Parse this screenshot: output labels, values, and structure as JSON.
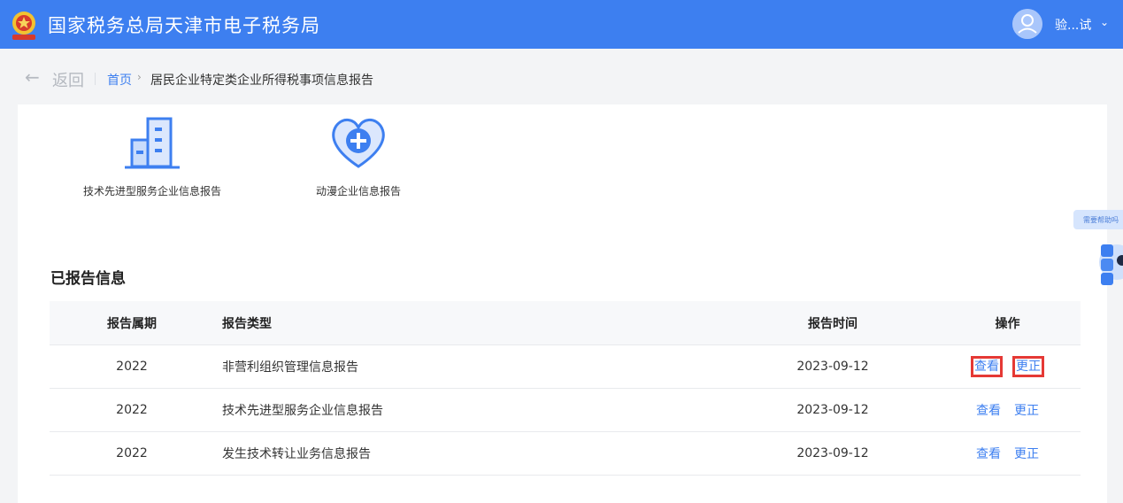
{
  "header": {
    "site_title": "国家税务总局天津市电子税务局",
    "user_name": "验...试",
    "chevron": "⌄",
    "colors": {
      "bar": "#3d7ff0"
    }
  },
  "breadcrumb": {
    "back_arrow": "←",
    "back_label": "返回",
    "home": "首页",
    "separator": "›",
    "current": "居民企业特定类企业所得税事项信息报告"
  },
  "cards": [
    {
      "label": "技术先进型服务企业信息报告",
      "icon": "building-icon"
    },
    {
      "label": "动漫企业信息报告",
      "icon": "heart-plus-icon"
    }
  ],
  "reported": {
    "title": "已报告信息",
    "columns": {
      "period": "报告属期",
      "type": "报告类型",
      "time": "报告时间",
      "ops": "操作"
    },
    "rows": [
      {
        "period": "2022",
        "type": "非营利组织管理信息报告",
        "time": "2023-09-12",
        "view": "查看",
        "correct": "更正"
      },
      {
        "period": "2022",
        "type": "技术先进型服务企业信息报告",
        "time": "2023-09-12",
        "view": "查看",
        "correct": "更正"
      },
      {
        "period": "2022",
        "type": "发生技术转让业务信息报告",
        "time": "2023-09-12",
        "view": "查看",
        "correct": "更正"
      }
    ],
    "highlight_color": "#e53935"
  },
  "help": {
    "tab_label": "需要帮助吗"
  }
}
